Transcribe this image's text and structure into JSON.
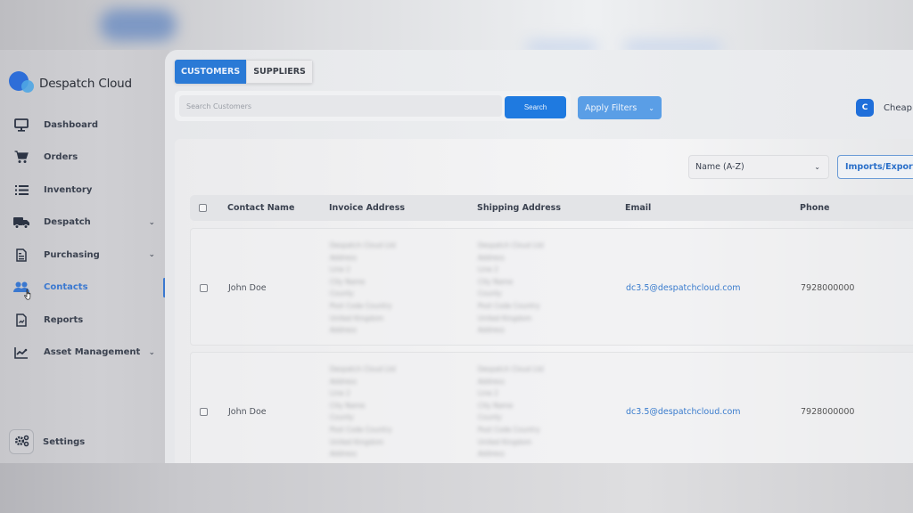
{
  "brand": {
    "name": "Despatch Cloud",
    "primary_color": "#2a7ad6",
    "accent_color": "#3a78d0"
  },
  "sidebar": {
    "items": [
      {
        "label": "Dashboard",
        "icon": "monitor-icon",
        "has_submenu": false,
        "active": false
      },
      {
        "label": "Orders",
        "icon": "cart-icon",
        "has_submenu": false,
        "active": false
      },
      {
        "label": "Inventory",
        "icon": "list-icon",
        "has_submenu": false,
        "active": false
      },
      {
        "label": "Despatch",
        "icon": "truck-icon",
        "has_submenu": true,
        "active": false
      },
      {
        "label": "Purchasing",
        "icon": "document-icon",
        "has_submenu": true,
        "active": false
      },
      {
        "label": "Contacts",
        "icon": "users-icon",
        "has_submenu": false,
        "active": true
      },
      {
        "label": "Reports",
        "icon": "report-file-icon",
        "has_submenu": false,
        "active": false
      },
      {
        "label": "Asset Management",
        "icon": "chart-line-icon",
        "has_submenu": true,
        "active": false
      }
    ],
    "settings_label": "Settings"
  },
  "tabs": [
    {
      "label": "CUSTOMERS",
      "active": true
    },
    {
      "label": "SUPPLIERS",
      "active": false
    }
  ],
  "search": {
    "placeholder": "Search Customers",
    "value": "",
    "button_label": "Search"
  },
  "filters": {
    "button_label": "Apply Filters"
  },
  "account": {
    "initial": "C",
    "name": "Cheap"
  },
  "toolbar": {
    "sort_selected": "Name (A-Z)",
    "imports_exports_label": "Imports/Exports"
  },
  "table": {
    "columns": [
      "Contact Name",
      "Invoice Address",
      "Shipping Address",
      "Email",
      "Phone"
    ],
    "rows": [
      {
        "contact_name": "John Doe",
        "invoice_address": [
          "Despatch Cloud Ltd",
          "Address",
          "Line 2",
          "City Name",
          "County",
          "Post Code Country",
          "United Kingdom",
          "Address"
        ],
        "shipping_address": [
          "Despatch Cloud Ltd",
          "Address",
          "Line 2",
          "City Name",
          "County",
          "Post Code Country",
          "United Kingdom",
          "Address"
        ],
        "email": "dc3.5@despatchcloud.com",
        "phone": "7928000000"
      },
      {
        "contact_name": "John Doe",
        "invoice_address": [
          "Despatch Cloud Ltd",
          "Address",
          "Line 2",
          "City Name",
          "County",
          "Post Code Country",
          "United Kingdom",
          "Address"
        ],
        "shipping_address": [
          "Despatch Cloud Ltd",
          "Address",
          "Line 2",
          "City Name",
          "County",
          "Post Code Country",
          "United Kingdom",
          "Address"
        ],
        "email": "dc3.5@despatchcloud.com",
        "phone": "7928000000"
      }
    ]
  }
}
